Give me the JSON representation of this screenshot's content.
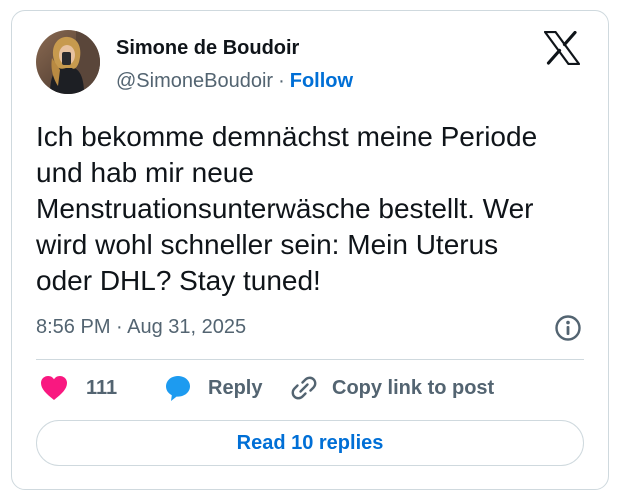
{
  "colors": {
    "border": "#cfd9de",
    "text_primary": "#0f1419",
    "text_secondary": "#536471",
    "link_blue": "#006fd6",
    "like_pink": "#f91880",
    "reply_blue": "#1d9bf0"
  },
  "tweet": {
    "author": {
      "name": "Simone de Boudoir",
      "handle": "@SimoneBoudoir",
      "separator": "·",
      "follow_label": "Follow"
    },
    "brand_icon": "x-logo-icon",
    "text": "Ich bekomme demnächst meine Periode\nund hab mir neue\nMenstruationsunterwäsche bestellt. Wer\nwird wohl schneller sein: Mein Uterus\noder DHL? Stay tuned!",
    "timestamp": "8:56 PM · Aug 31, 2025",
    "info_icon": "info-icon"
  },
  "actions": {
    "like": {
      "icon": "heart-icon",
      "count": "111"
    },
    "reply": {
      "icon": "speech-bubble-icon",
      "label": "Reply"
    },
    "copy_link": {
      "icon": "link-icon",
      "label": "Copy link to post"
    }
  },
  "footer": {
    "read_replies_label": "Read 10 replies"
  }
}
